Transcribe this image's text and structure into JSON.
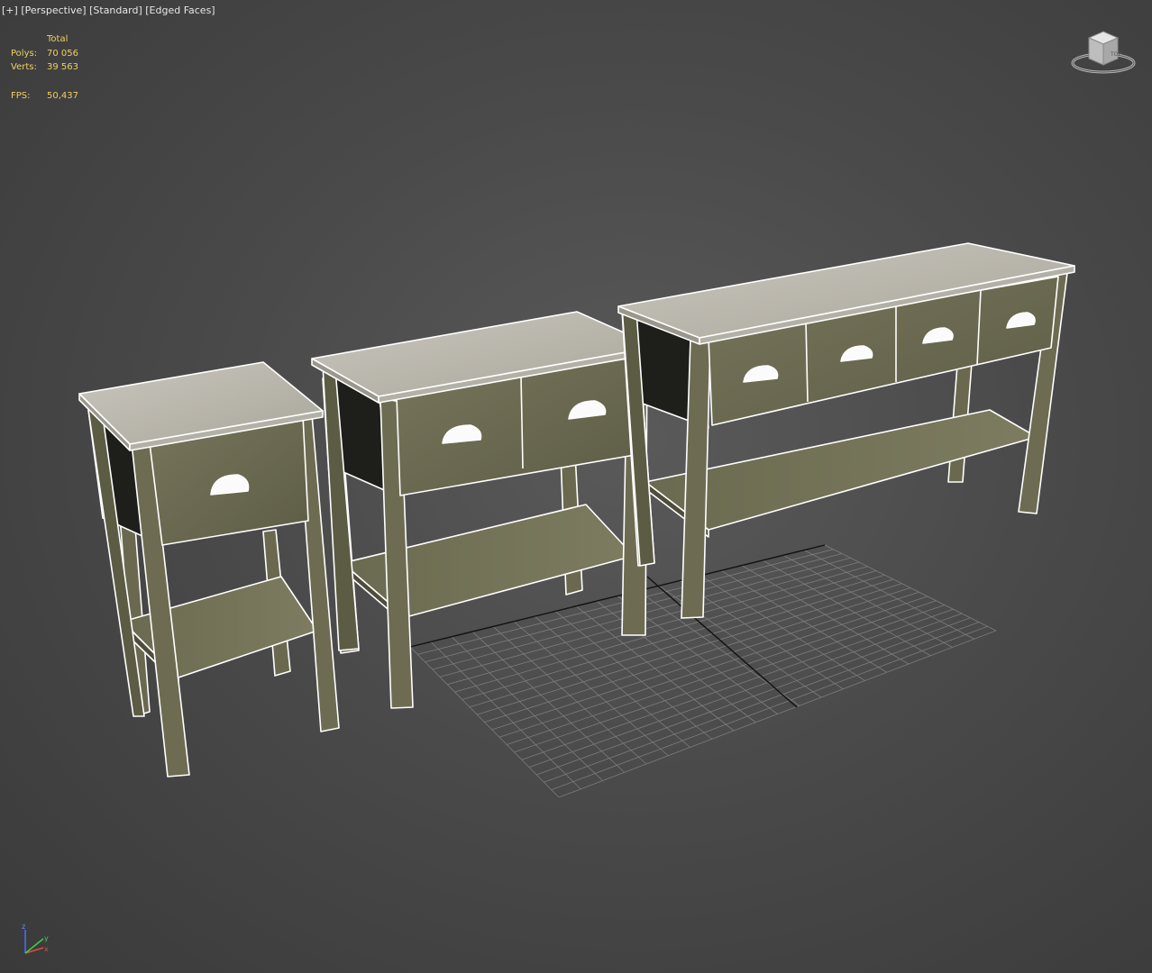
{
  "viewport": {
    "label_plus": "[+]",
    "label_view": "[Perspective]",
    "label_shading": "[Standard]",
    "label_mode": "[Edged Faces]"
  },
  "stats": {
    "header": "Total",
    "polys_label": "Polys:",
    "polys_value": "70 056",
    "verts_label": "Verts:",
    "verts_value": "39 563",
    "fps_label": "FPS:",
    "fps_value": "50,437"
  },
  "viewcube": {
    "icon": "viewcube-icon",
    "face_label": "TOP"
  },
  "axis_gizmo": {
    "icon": "axis-tripod-icon",
    "z": "z",
    "x": "x",
    "y": "y"
  },
  "colors": {
    "background": "#4a4a4a",
    "wood_top": "#bfbcb3",
    "wood_face": "#6d6b52",
    "wood_dark": "#1c1c18",
    "edge": "#ffffff",
    "stats_text": "#f0d060",
    "grid": "#8a8a8a"
  }
}
